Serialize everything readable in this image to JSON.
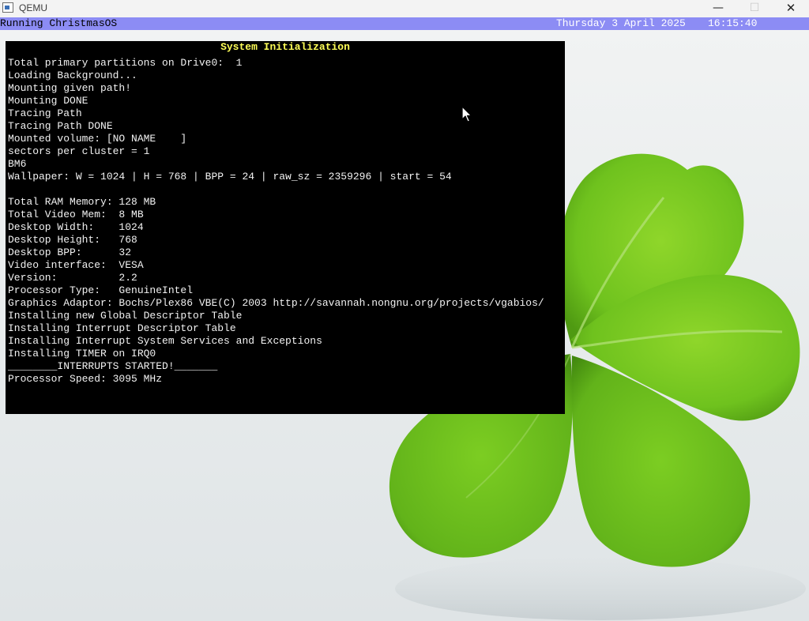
{
  "window": {
    "title": "QEMU",
    "minimize_glyph": "—",
    "maximize_glyph": "☐",
    "close_glyph": "✕"
  },
  "os_bar": {
    "status": "Running ChristmasOS",
    "date": "Thursday 3 April 2025",
    "time": "16:15:40"
  },
  "console": {
    "title": "System Initialization",
    "lines": [
      "Total primary partitions on Drive0:  1",
      "Loading Background...",
      "Mounting given path!",
      "Mounting DONE",
      "Tracing Path",
      "Tracing Path DONE",
      "Mounted volume: [NO NAME    ]",
      "sectors per cluster = 1",
      "BM6",
      "Wallpaper: W = 1024 | H = 768 | BPP = 24 | raw_sz = 2359296 | start = 54",
      "",
      "Total RAM Memory: 128 MB",
      "Total Video Mem:  8 MB",
      "Desktop Width:    1024",
      "Desktop Height:   768",
      "Desktop BPP:      32",
      "Video interface:  VESA",
      "Version:          2.2",
      "Processor Type:   GenuineIntel",
      "Graphics Adaptor: Bochs/Plex86 VBE(C) 2003 http://savannah.nongnu.org/projects/vgabios/",
      "Installing new Global Descriptor Table",
      "Installing Interrupt Descriptor Table",
      "Installing Interrupt System Services and Exceptions",
      "Installing TIMER on IRQ0",
      "________INTERRUPTS STARTED!_______",
      "Processor Speed: 3095 MHz"
    ]
  },
  "colors": {
    "os_bar": "#8c8cf4",
    "console_bg": "#000000",
    "console_title": "#ffff57",
    "console_text": "#f2f2f2",
    "clover_leaf": "#6fc21e"
  },
  "icons": {
    "app": "qemu-app-icon",
    "pointer": "mouse-pointer-icon"
  }
}
